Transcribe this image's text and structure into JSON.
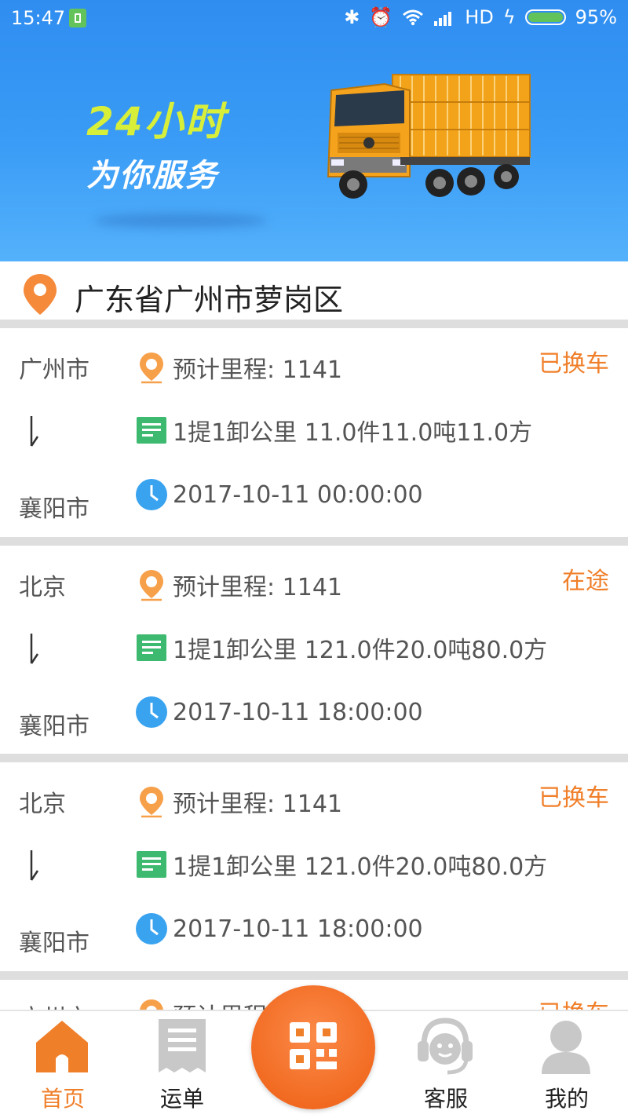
{
  "status_bar": {
    "time": "15:47",
    "network": "HD",
    "battery": "95%"
  },
  "banner": {
    "slogan_line1": "24小时",
    "slogan_line2": "为你服务"
  },
  "location": {
    "address": "广东省广州市萝岗区"
  },
  "orders": [
    {
      "from": "广州市",
      "to": "襄阳市",
      "status": "已换车",
      "mileage": "预计里程: 1141",
      "cargo": "1提1卸公里 11.0件11.0吨11.0方",
      "time": "2017-10-11 00:00:00"
    },
    {
      "from": "北京",
      "to": "襄阳市",
      "status": "在途",
      "mileage": "预计里程: 1141",
      "cargo": "1提1卸公里 121.0件20.0吨80.0方",
      "time": "2017-10-11 18:00:00"
    },
    {
      "from": "北京",
      "to": "襄阳市",
      "status": "已换车",
      "mileage": "预计里程: 1141",
      "cargo": "1提1卸公里 121.0件20.0吨80.0方",
      "time": "2017-10-11 18:00:00"
    },
    {
      "from": "广州市",
      "status": "已换车",
      "mileage": "预计里程"
    }
  ],
  "nav": {
    "items": [
      {
        "label": "首页",
        "icon": "home-icon",
        "active": true
      },
      {
        "label": "运单",
        "icon": "waybill-icon",
        "active": false
      },
      {
        "label": "",
        "icon": "qr-scan-icon",
        "active": false
      },
      {
        "label": "客服",
        "icon": "customer-service-icon",
        "active": false
      },
      {
        "label": "我的",
        "icon": "profile-icon",
        "active": false
      }
    ]
  },
  "colors": {
    "accent": "#f07f2a",
    "banner_blue": "#3a9cf6",
    "green": "#3dba6f",
    "clock_blue": "#3aa3f0"
  }
}
